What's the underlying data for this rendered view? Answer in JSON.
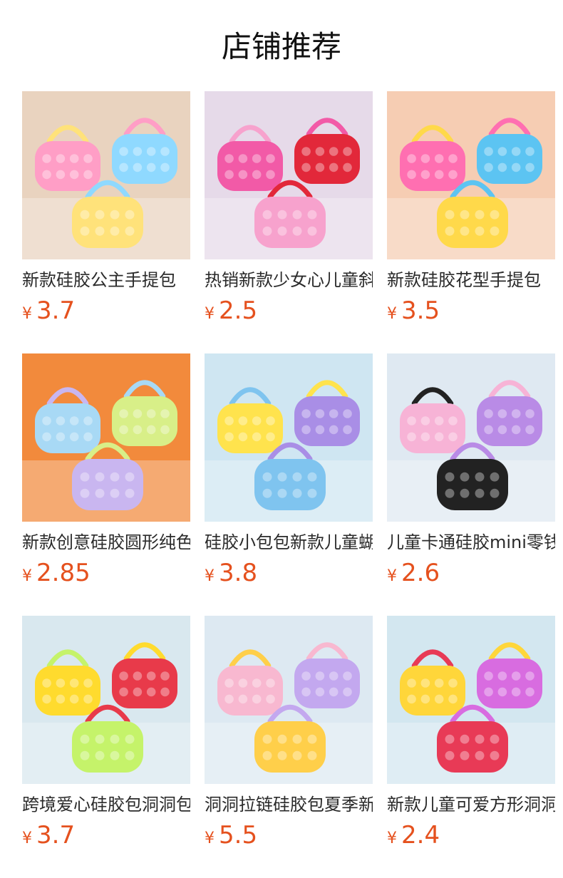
{
  "page": {
    "title": "店铺推荐"
  },
  "products": [
    {
      "name": "新款硅胶公主手提包",
      "currency": "¥",
      "price": "3.7",
      "image": {
        "bg": "#e9d3bf",
        "accent": "#ff9ec6",
        "accent2": "#8fd9ff",
        "accent3": "#ffe27a"
      }
    },
    {
      "name": "热销新款少女心儿童斜挎包",
      "currency": "¥",
      "price": "2.5",
      "image": {
        "bg": "#e6dae9",
        "accent": "#f25aa7",
        "accent2": "#e2283a",
        "accent3": "#f7a2cd"
      }
    },
    {
      "name": "新款硅胶花型手提包",
      "currency": "¥",
      "price": "3.5",
      "image": {
        "bg": "#f6cdb3",
        "accent": "#ff6fb1",
        "accent2": "#5cc4f2",
        "accent3": "#ffd94a"
      }
    },
    {
      "name": "新款创意硅胶圆形纯色零钱包",
      "currency": "¥",
      "price": "2.85",
      "image": {
        "bg": "#f28a3c",
        "accent": "#a8d9f5",
        "accent2": "#d8ef88",
        "accent3": "#c9b6f0"
      }
    },
    {
      "name": "硅胶小包包新款儿童蝴蝶包",
      "currency": "¥",
      "price": "3.8",
      "image": {
        "bg": "#cfe6f2",
        "accent": "#ffe34d",
        "accent2": "#a98ee6",
        "accent3": "#7fc4ef"
      }
    },
    {
      "name": "儿童卡通硅胶mini零钱包",
      "currency": "¥",
      "price": "2.6",
      "image": {
        "bg": "#dfe9f2",
        "accent": "#f7b3d6",
        "accent2": "#b98be6",
        "accent3": "#222222"
      }
    },
    {
      "name": "跨境爱心硅胶包洞洞包",
      "currency": "¥",
      "price": "3.7",
      "image": {
        "bg": "#d9e8ef",
        "accent": "#ffdb2e",
        "accent2": "#e83a4a",
        "accent3": "#c5f36a"
      }
    },
    {
      "name": "洞洞拉链硅胶包夏季新款",
      "currency": "¥",
      "price": "5.5",
      "image": {
        "bg": "#dde9f2",
        "accent": "#f8b8d0",
        "accent2": "#c3a8ef",
        "accent3": "#ffcf4a"
      }
    },
    {
      "name": "新款儿童可爱方形洞洞包",
      "currency": "¥",
      "price": "2.4",
      "image": {
        "bg": "#d3e7f0",
        "accent": "#ffd63a",
        "accent2": "#d86ce0",
        "accent3": "#e83a56"
      }
    }
  ]
}
